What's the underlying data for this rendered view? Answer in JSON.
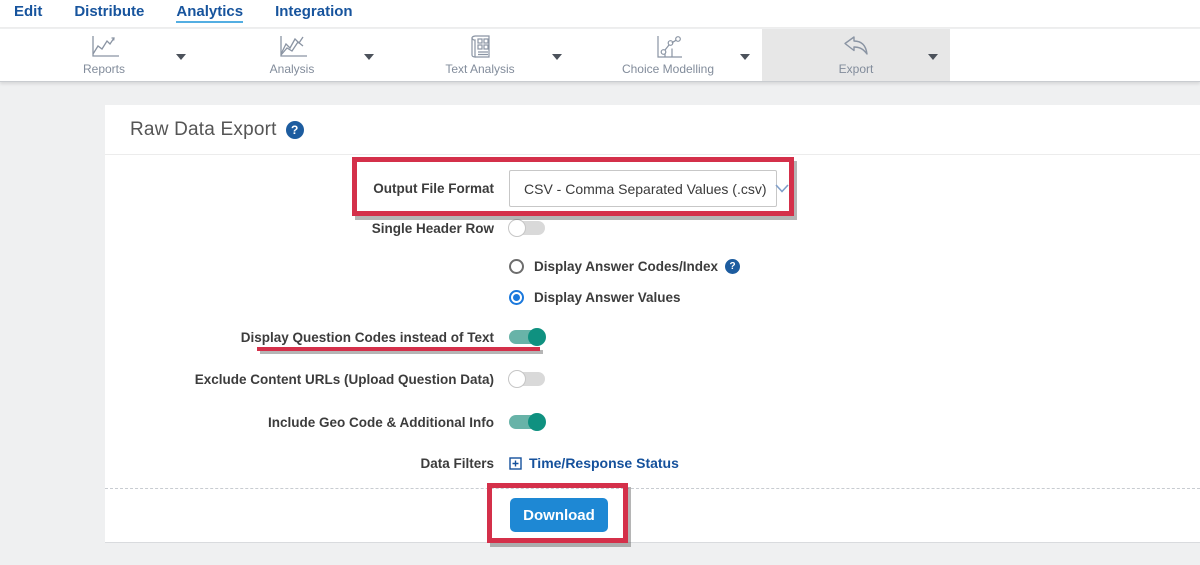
{
  "nav": {
    "items": [
      {
        "label": "Edit",
        "active": false
      },
      {
        "label": "Distribute",
        "active": false
      },
      {
        "label": "Analytics",
        "active": true
      },
      {
        "label": "Integration",
        "active": false
      }
    ]
  },
  "toolbar": {
    "items": [
      {
        "label": "Reports",
        "icon": "line-chart-icon",
        "selected": false
      },
      {
        "label": "Analysis",
        "icon": "multi-line-chart-icon",
        "selected": false
      },
      {
        "label": "Text Analysis",
        "icon": "document-grid-icon",
        "selected": false
      },
      {
        "label": "Choice Modelling",
        "icon": "scatter-chart-icon",
        "selected": false
      },
      {
        "label": "Export",
        "icon": "export-arrow-icon",
        "selected": true
      }
    ]
  },
  "page": {
    "title": "Raw Data Export",
    "form": {
      "output_format": {
        "label": "Output File Format",
        "value": "CSV - Comma Separated Values (.csv)"
      },
      "single_header": {
        "label": "Single Header Row",
        "state": "off"
      },
      "radios": [
        {
          "label": "Display Answer Codes/Index",
          "selected": false,
          "has_help": true
        },
        {
          "label": "Display Answer Values",
          "selected": true,
          "has_help": false
        }
      ],
      "question_codes": {
        "label": "Display Question Codes instead of Text",
        "state": "on"
      },
      "exclude_urls": {
        "label": "Exclude Content URLs (Upload Question Data)",
        "state": "off"
      },
      "geo_code": {
        "label": "Include Geo Code & Additional Info",
        "state": "on"
      },
      "data_filters": {
        "label": "Data Filters",
        "link_label": "Time/Response Status"
      },
      "download_label": "Download"
    }
  },
  "glyphs": {
    "question_mark": "?"
  },
  "colors": {
    "annotation_red": "#d4304a",
    "toggle_on_knob": "#0f9180",
    "toggle_on_track": "#68b3a8",
    "download_blue": "#1e88d4",
    "link_blue": "#15519c",
    "radio_blue": "#1a78dc",
    "nav_blue": "#17549d",
    "active_underline_blue": "#53aee2",
    "help_icon_blue": "#1d5c9f",
    "page_bg": "#eff0f1"
  }
}
